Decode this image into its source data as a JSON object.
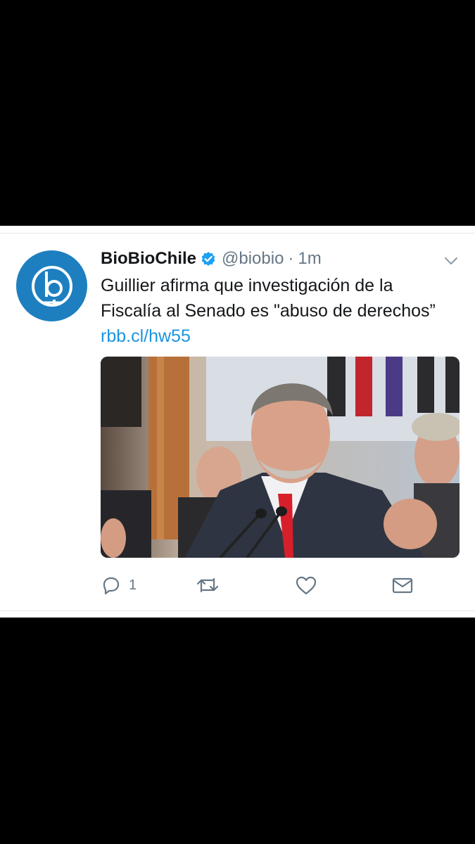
{
  "tweet": {
    "display_name": "BioBioChile",
    "verified": true,
    "handle": "@biobio",
    "separator": "·",
    "time": "1m",
    "text_main": "Guillier afirma que investigación de la Fiscalía al Senado es \"abuso de derechos”",
    "link_text": "rbb.cl/hw55",
    "reply_count": "1"
  },
  "icons": {
    "avatar": "biobio-logo-icon",
    "verified": "verified-badge-icon",
    "more": "chevron-down-icon",
    "reply": "reply-icon",
    "retweet": "retweet-icon",
    "like": "heart-icon",
    "dm": "envelope-icon"
  },
  "colors": {
    "avatar_bg": "#1d7fbf",
    "verified": "#1da1f2",
    "link": "#1b95e0",
    "muted": "#657786",
    "text": "#14171a"
  }
}
